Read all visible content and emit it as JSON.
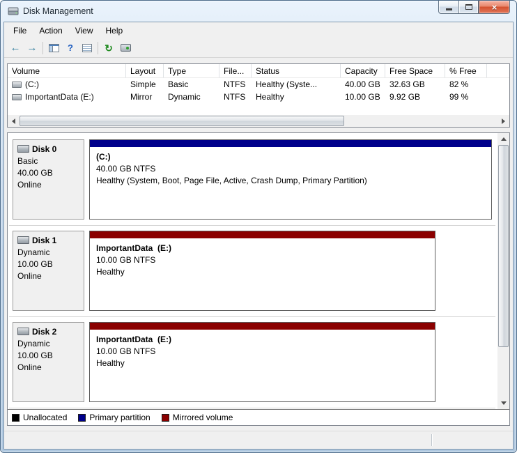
{
  "window": {
    "title": "Disk Management"
  },
  "icons": {
    "back": "←",
    "forward": "→",
    "help": "?",
    "refresh": "↻",
    "close": "×"
  },
  "menu": {
    "items": [
      "File",
      "Action",
      "View",
      "Help"
    ]
  },
  "volume_table": {
    "columns": [
      "Volume",
      "Layout",
      "Type",
      "File...",
      "Status",
      "Capacity",
      "Free Space",
      "% Free"
    ],
    "rows": [
      {
        "volume": "(C:)",
        "layout": "Simple",
        "type": "Basic",
        "fs": "NTFS",
        "status": "Healthy (Syste...",
        "capacity": "40.00 GB",
        "free": "32.63 GB",
        "pct": "82 %"
      },
      {
        "volume": "ImportantData (E:)",
        "layout": "Mirror",
        "type": "Dynamic",
        "fs": "NTFS",
        "status": "Healthy",
        "capacity": "10.00 GB",
        "free": "9.92 GB",
        "pct": "99 %"
      }
    ]
  },
  "disks": [
    {
      "name": "Disk 0",
      "kind": "Basic",
      "size": "40.00 GB",
      "state": "Online",
      "volume": "(C:)",
      "detail": "40.00 GB NTFS",
      "status": "Healthy (System, Boot, Page File, Active, Crash Dump, Primary Partition)",
      "bar_color": "#00008b",
      "bar_width": "100%"
    },
    {
      "name": "Disk 1",
      "kind": "Dynamic",
      "size": "10.00 GB",
      "state": "Online",
      "volume": "ImportantData  (E:)",
      "detail": "10.00 GB NTFS",
      "status": "Healthy",
      "bar_color": "#8b0000",
      "bar_width": "86%"
    },
    {
      "name": "Disk 2",
      "kind": "Dynamic",
      "size": "10.00 GB",
      "state": "Online",
      "volume": "ImportantData  (E:)",
      "detail": "10.00 GB NTFS",
      "status": "Healthy",
      "bar_color": "#8b0000",
      "bar_width": "86%"
    }
  ],
  "legend": {
    "items": [
      {
        "label": "Unallocated",
        "color": "#000000"
      },
      {
        "label": "Primary partition",
        "color": "#00008b"
      },
      {
        "label": "Mirrored volume",
        "color": "#8b0000"
      }
    ]
  }
}
